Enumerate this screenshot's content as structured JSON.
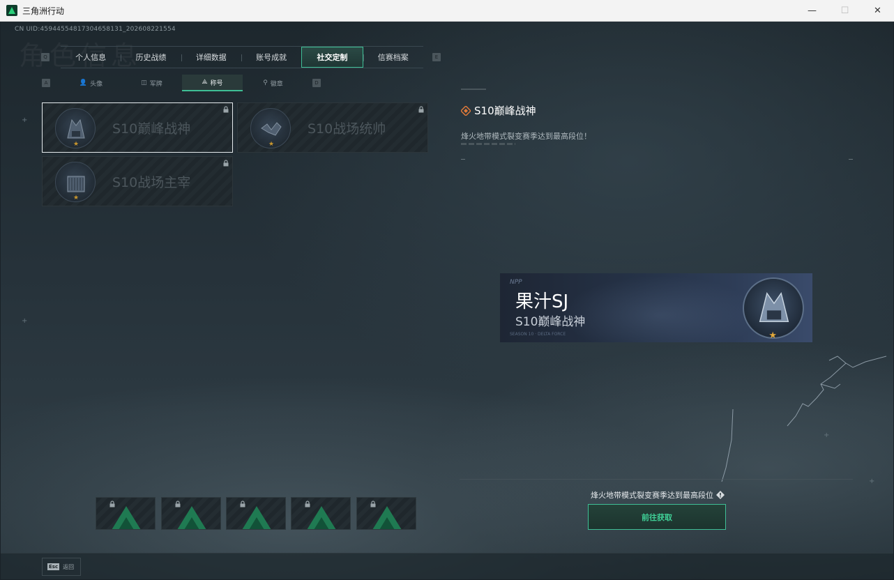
{
  "window": {
    "title": "三角洲行动",
    "min_glyph": "—",
    "max_glyph": "☐",
    "close_glyph": "✕"
  },
  "uid": "CN UID:4594455481730465813​1_2026082​21554",
  "bg_title": "角色信息",
  "tabs": {
    "left_key": "Q",
    "right_key": "E",
    "items": [
      {
        "label": "个人信息",
        "active": false
      },
      {
        "label": "历史战绩",
        "active": false
      },
      {
        "label": "详细数据",
        "active": false
      },
      {
        "label": "账号成就",
        "active": false
      },
      {
        "label": "社交定制",
        "active": true
      },
      {
        "label": "信赛档案",
        "active": false
      }
    ]
  },
  "subtabs": {
    "left_key": "A",
    "right_key": "D",
    "items": [
      {
        "label": "头像",
        "icon": "person-icon",
        "glyph": "👤",
        "active": false
      },
      {
        "label": "军牌",
        "icon": "dogtag-icon",
        "glyph": "◫",
        "active": false
      },
      {
        "label": "称号",
        "icon": "title-icon",
        "glyph": "⟁",
        "active": true
      },
      {
        "label": "徽章",
        "icon": "badge-icon",
        "glyph": "⚲",
        "active": false
      }
    ]
  },
  "cards": [
    {
      "name": "S10巅峰战神",
      "selected": true,
      "locked": true,
      "icon": "peak-god-emblem-icon"
    },
    {
      "name": "S10战场统帅",
      "selected": false,
      "locked": true,
      "icon": "marshal-emblem-icon"
    },
    {
      "name": "S10战场主宰",
      "selected": false,
      "locked": true,
      "icon": "overlord-emblem-icon"
    }
  ],
  "detail": {
    "title": "S10巅峰战神",
    "description": "烽火地带模式裂变赛季达到最高段位！"
  },
  "preview": {
    "brand": "NPP",
    "player_name": "果汁SJ",
    "title": "S10巅峰战神",
    "footer": "SEASON 10 · DELTA FORCE"
  },
  "acquire": {
    "description": "烽火地带模式裂变赛季达到最高段位",
    "button_label": "前往获取",
    "accent": "#3fbf96"
  },
  "thumbs_count": 5,
  "bottom": {
    "esc_key": "Esc",
    "esc_label": "返回"
  }
}
